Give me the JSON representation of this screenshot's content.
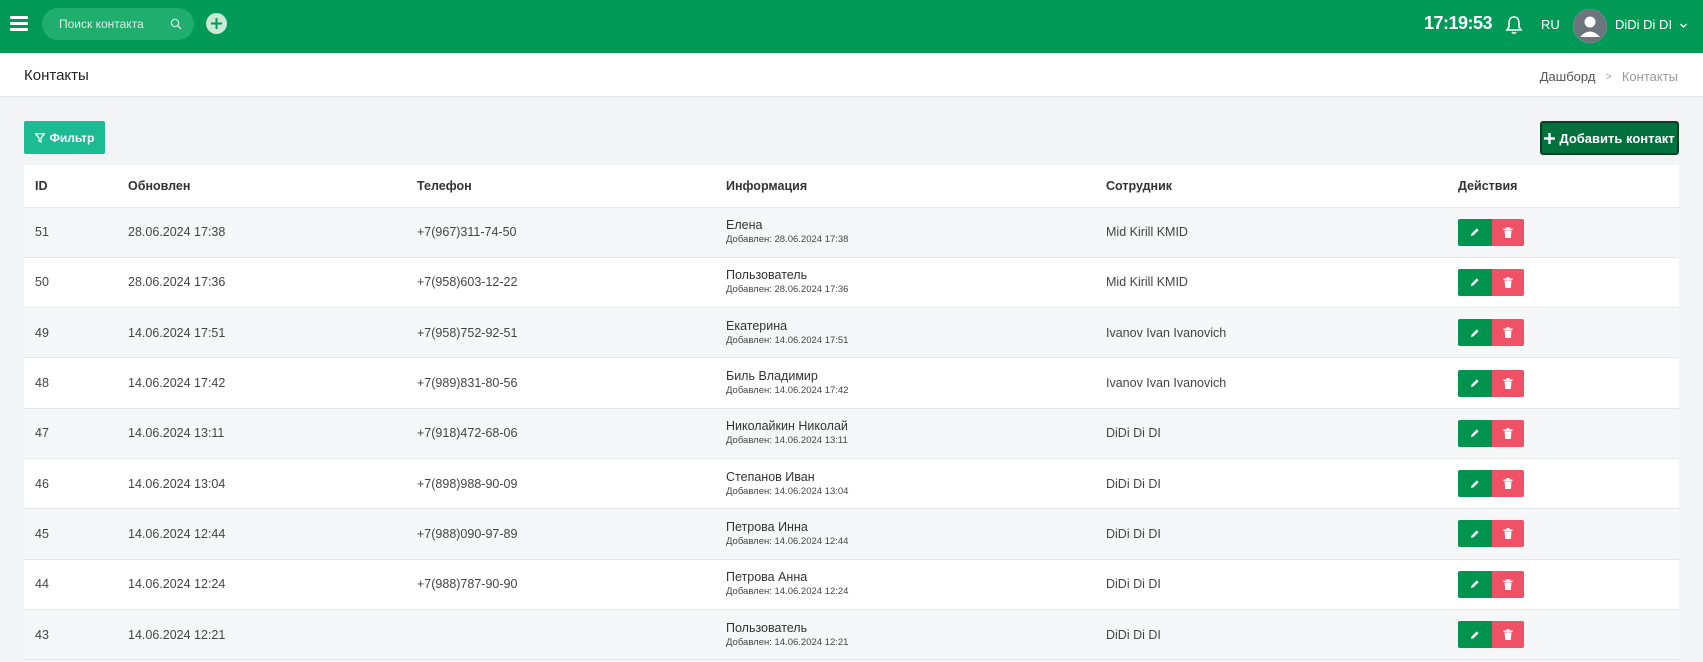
{
  "topbar": {
    "search_placeholder": "Поиск контакта",
    "clock": "17:19:53",
    "lang": "RU",
    "username": "DiDi Di DI",
    "bg_color": "#009a56"
  },
  "page": {
    "title": "Контакты",
    "breadcrumb": [
      "Дашборд",
      "Контакты"
    ]
  },
  "toolbar": {
    "filter_label": "Фильтр",
    "add_label": "Добавить контакт"
  },
  "table": {
    "headers": [
      "ID",
      "Обновлен",
      "Телефон",
      "Информация",
      "Сотрудник",
      "Действия"
    ],
    "rows": [
      {
        "id": "51",
        "updated": "28.06.2024 17:38",
        "phone": "+7(967)311-74-50",
        "name": "Елена",
        "added": "Добавлен: 28.06.2024 17:38",
        "employee": "Mid Kirill KMID"
      },
      {
        "id": "50",
        "updated": "28.06.2024 17:36",
        "phone": "+7(958)603-12-22",
        "name": "Пользователь",
        "added": "Добавлен: 28.06.2024 17:36",
        "employee": "Mid Kirill KMID"
      },
      {
        "id": "49",
        "updated": "14.06.2024 17:51",
        "phone": "+7(958)752-92-51",
        "name": "Екатерина",
        "added": "Добавлен: 14.06.2024 17:51",
        "employee": "Ivanov Ivan Ivanovich"
      },
      {
        "id": "48",
        "updated": "14.06.2024 17:42",
        "phone": "+7(989)831-80-56",
        "name": "Биль Владимир",
        "added": "Добавлен: 14.06.2024 17:42",
        "employee": "Ivanov Ivan Ivanovich"
      },
      {
        "id": "47",
        "updated": "14.06.2024 13:11",
        "phone": "+7(918)472-68-06",
        "name": "Николайкин Николай",
        "added": "Добавлен: 14.06.2024 13:11",
        "employee": "DiDi Di DI"
      },
      {
        "id": "46",
        "updated": "14.06.2024 13:04",
        "phone": "+7(898)988-90-09",
        "name": "Степанов Иван",
        "added": "Добавлен: 14.06.2024 13:04",
        "employee": "DiDi Di DI"
      },
      {
        "id": "45",
        "updated": "14.06.2024 12:44",
        "phone": "+7(988)090-97-89",
        "name": "Петрова Инна",
        "added": "Добавлен: 14.06.2024 12:44",
        "employee": "DiDi Di DI"
      },
      {
        "id": "44",
        "updated": "14.06.2024 12:24",
        "phone": "+7(988)787-90-90",
        "name": "Петрова Анна",
        "added": "Добавлен: 14.06.2024 12:24",
        "employee": "DiDi Di DI"
      },
      {
        "id": "43",
        "updated": "14.06.2024 12:21",
        "phone": "",
        "name": "Пользователь",
        "added": "Добавлен: 14.06.2024 12:21",
        "employee": "DiDi Di DI"
      }
    ]
  },
  "colors": {
    "edit": "#00944e",
    "delete": "#ef5167",
    "filter": "#1cbb93",
    "add": "#00703d"
  }
}
